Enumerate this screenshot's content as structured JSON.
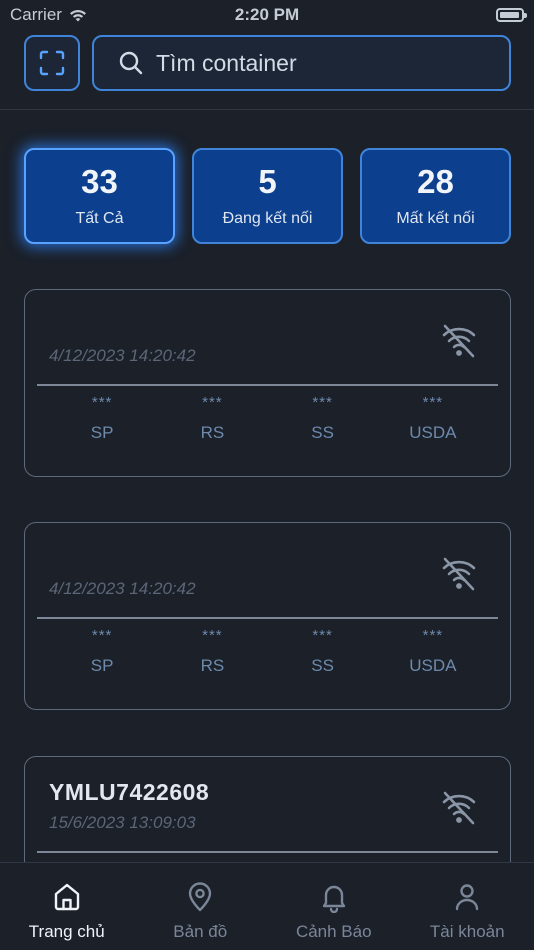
{
  "status_bar": {
    "carrier": "Carrier",
    "time": "2:20 PM"
  },
  "search": {
    "placeholder": "Tìm container"
  },
  "stats": [
    {
      "count": "33",
      "label": "Tất Cả",
      "active": true
    },
    {
      "count": "5",
      "label": "Đang kết nối",
      "active": false
    },
    {
      "count": "28",
      "label": "Mất kết nối",
      "active": false
    }
  ],
  "cards": [
    {
      "title": "",
      "time": "4/12/2023 14:20:42",
      "status_icon": "wifi-off-icon",
      "metrics": [
        {
          "value": "***",
          "label": "SP"
        },
        {
          "value": "***",
          "label": "RS"
        },
        {
          "value": "***",
          "label": "SS"
        },
        {
          "value": "***",
          "label": "USDA"
        }
      ]
    },
    {
      "title": "",
      "time": "4/12/2023 14:20:42",
      "status_icon": "wifi-off-icon",
      "metrics": [
        {
          "value": "***",
          "label": "SP"
        },
        {
          "value": "***",
          "label": "RS"
        },
        {
          "value": "***",
          "label": "SS"
        },
        {
          "value": "***",
          "label": "USDA"
        }
      ]
    },
    {
      "title": "YMLU7422608",
      "time": "15/6/2023 13:09:03",
      "status_icon": "wifi-off-icon",
      "metrics": []
    }
  ],
  "nav": [
    {
      "label": "Trang chủ",
      "icon": "home-icon",
      "active": true
    },
    {
      "label": "Bản đồ",
      "icon": "map-pin-icon",
      "active": false
    },
    {
      "label": "Cảnh Báo",
      "icon": "bell-icon",
      "active": false
    },
    {
      "label": "Tài khoản",
      "icon": "user-icon",
      "active": false
    }
  ],
  "colors": {
    "background": "#1b2029",
    "accent": "#3f84d8",
    "stat_fill": "#0c3f8e",
    "muted_text": "#6d8aad"
  }
}
